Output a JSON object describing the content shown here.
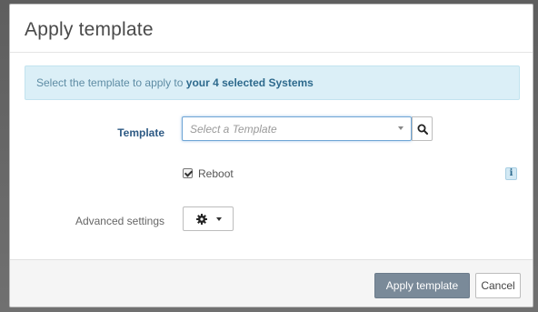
{
  "dialog": {
    "title": "Apply template"
  },
  "alert": {
    "prefix": "Select the template to apply to ",
    "strong": "your 4 selected Systems"
  },
  "form": {
    "template_label": "Template",
    "template_placeholder": "Select a Template",
    "reboot_label": "Reboot",
    "reboot_checked": true,
    "info_glyph": "i",
    "advanced_label": "Advanced settings"
  },
  "footer": {
    "apply_label": "Apply template",
    "cancel_label": "Cancel"
  },
  "icons": {
    "search": "search-icon",
    "gear": "gear-icon",
    "caret": "caret-down-icon",
    "info": "info-icon"
  },
  "colors": {
    "alert_bg": "#dbeff7",
    "primary_btn": "#7a8a99",
    "focus_border": "#6fa6d6",
    "label_accent": "#2e5a84"
  }
}
